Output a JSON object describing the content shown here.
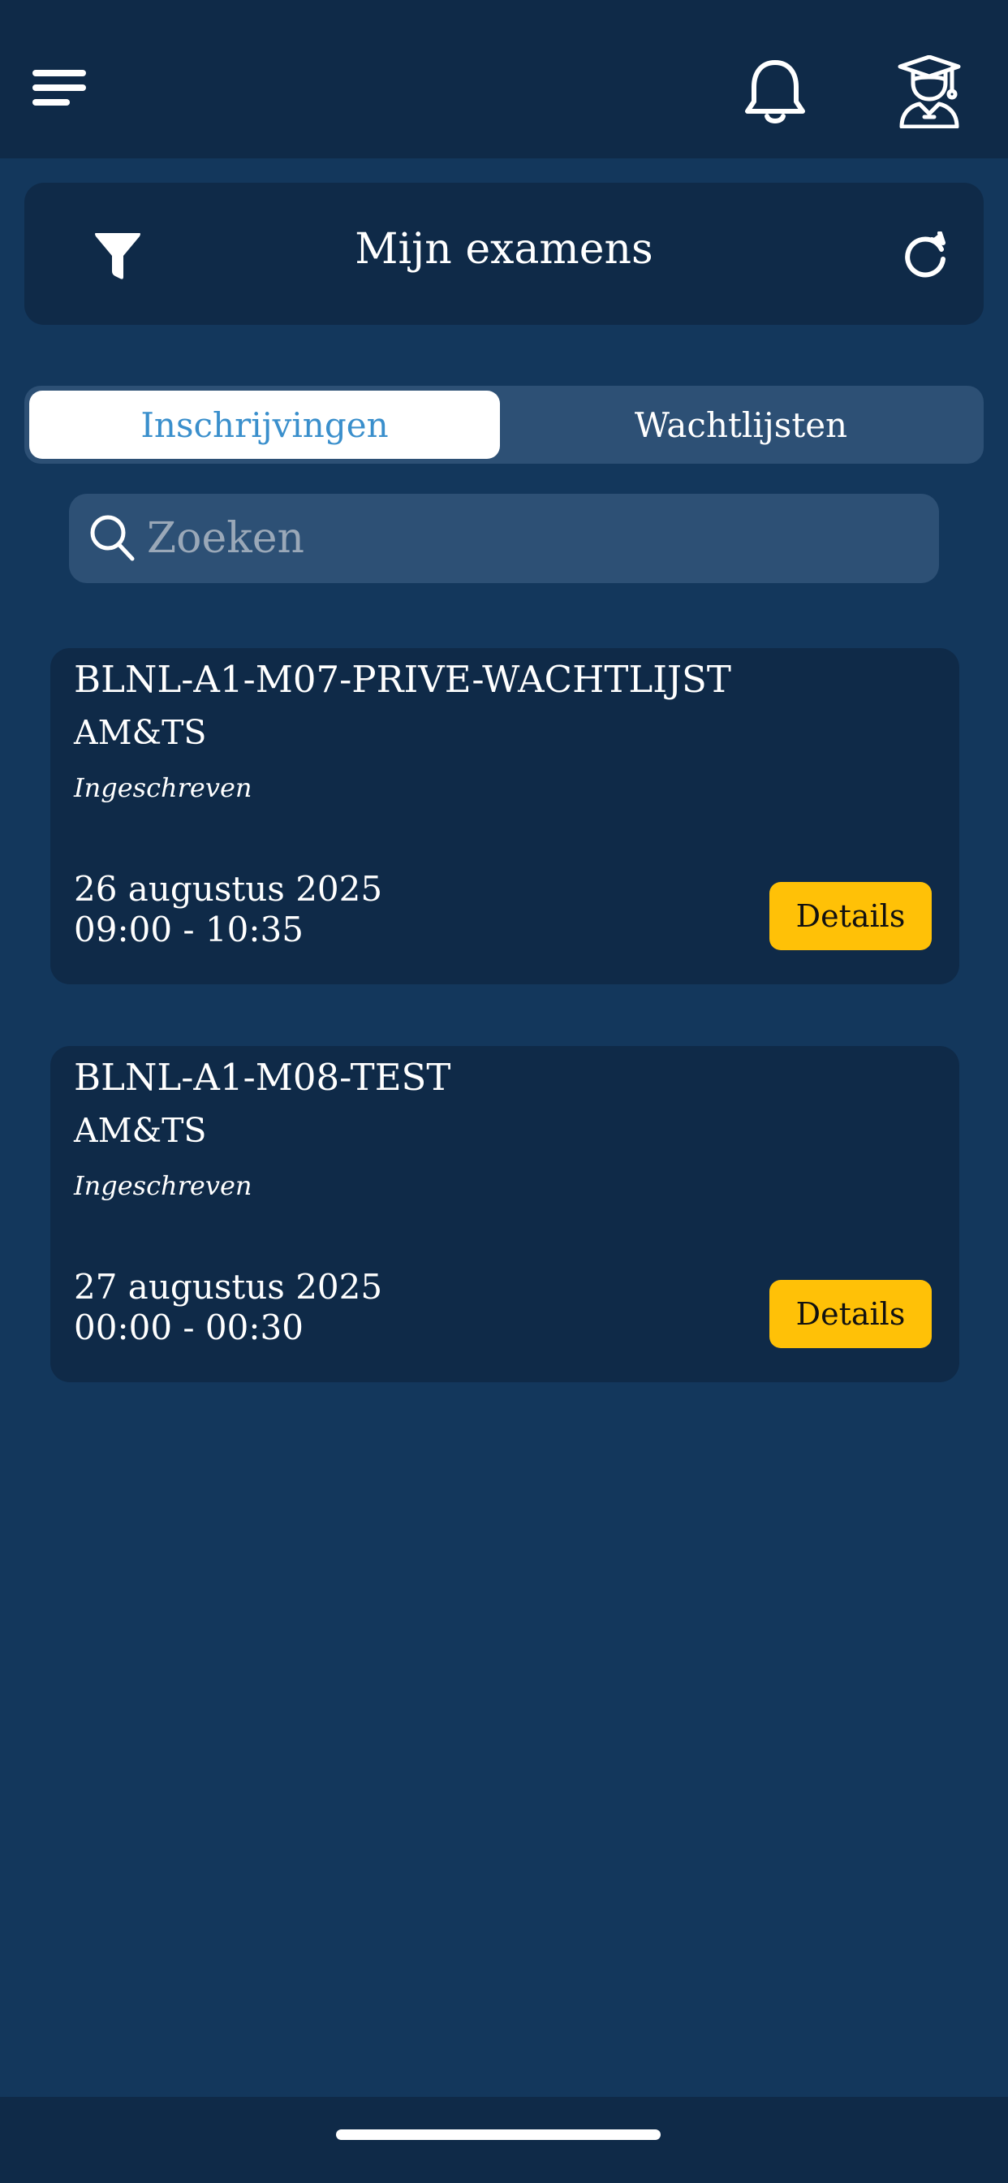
{
  "header": {
    "title": "Mijn examens",
    "icons": {
      "menu": "hamburger-menu-icon",
      "notifications": "bell-icon",
      "profile": "graduate-student-icon",
      "filter": "filter-funnel-icon",
      "refresh": "refresh-icon"
    }
  },
  "tabs": [
    {
      "label": "Inschrijvingen",
      "active": true
    },
    {
      "label": "Wachtlijsten",
      "active": false
    }
  ],
  "search": {
    "placeholder": "Zoeken",
    "value": ""
  },
  "exams": [
    {
      "code": "BLNL-A1-M07-PRIVE-WACHTLIJST",
      "organization": "AM&TS",
      "status": "Ingeschreven",
      "date": "26 augustus 2025",
      "time": "09:00 - 10:35",
      "action_label": "Details"
    },
    {
      "code": "BLNL-A1-M08-TEST",
      "organization": "AM&TS",
      "status": "Ingeschreven",
      "date": "27 augustus 2025",
      "time": "00:00 - 00:30",
      "action_label": "Details"
    }
  ],
  "colors": {
    "background": "#13375c",
    "bar": "#0f2a48",
    "accent_button": "#ffc107",
    "active_tab_text": "#3a8fcc",
    "input_background": "#2d5075"
  }
}
